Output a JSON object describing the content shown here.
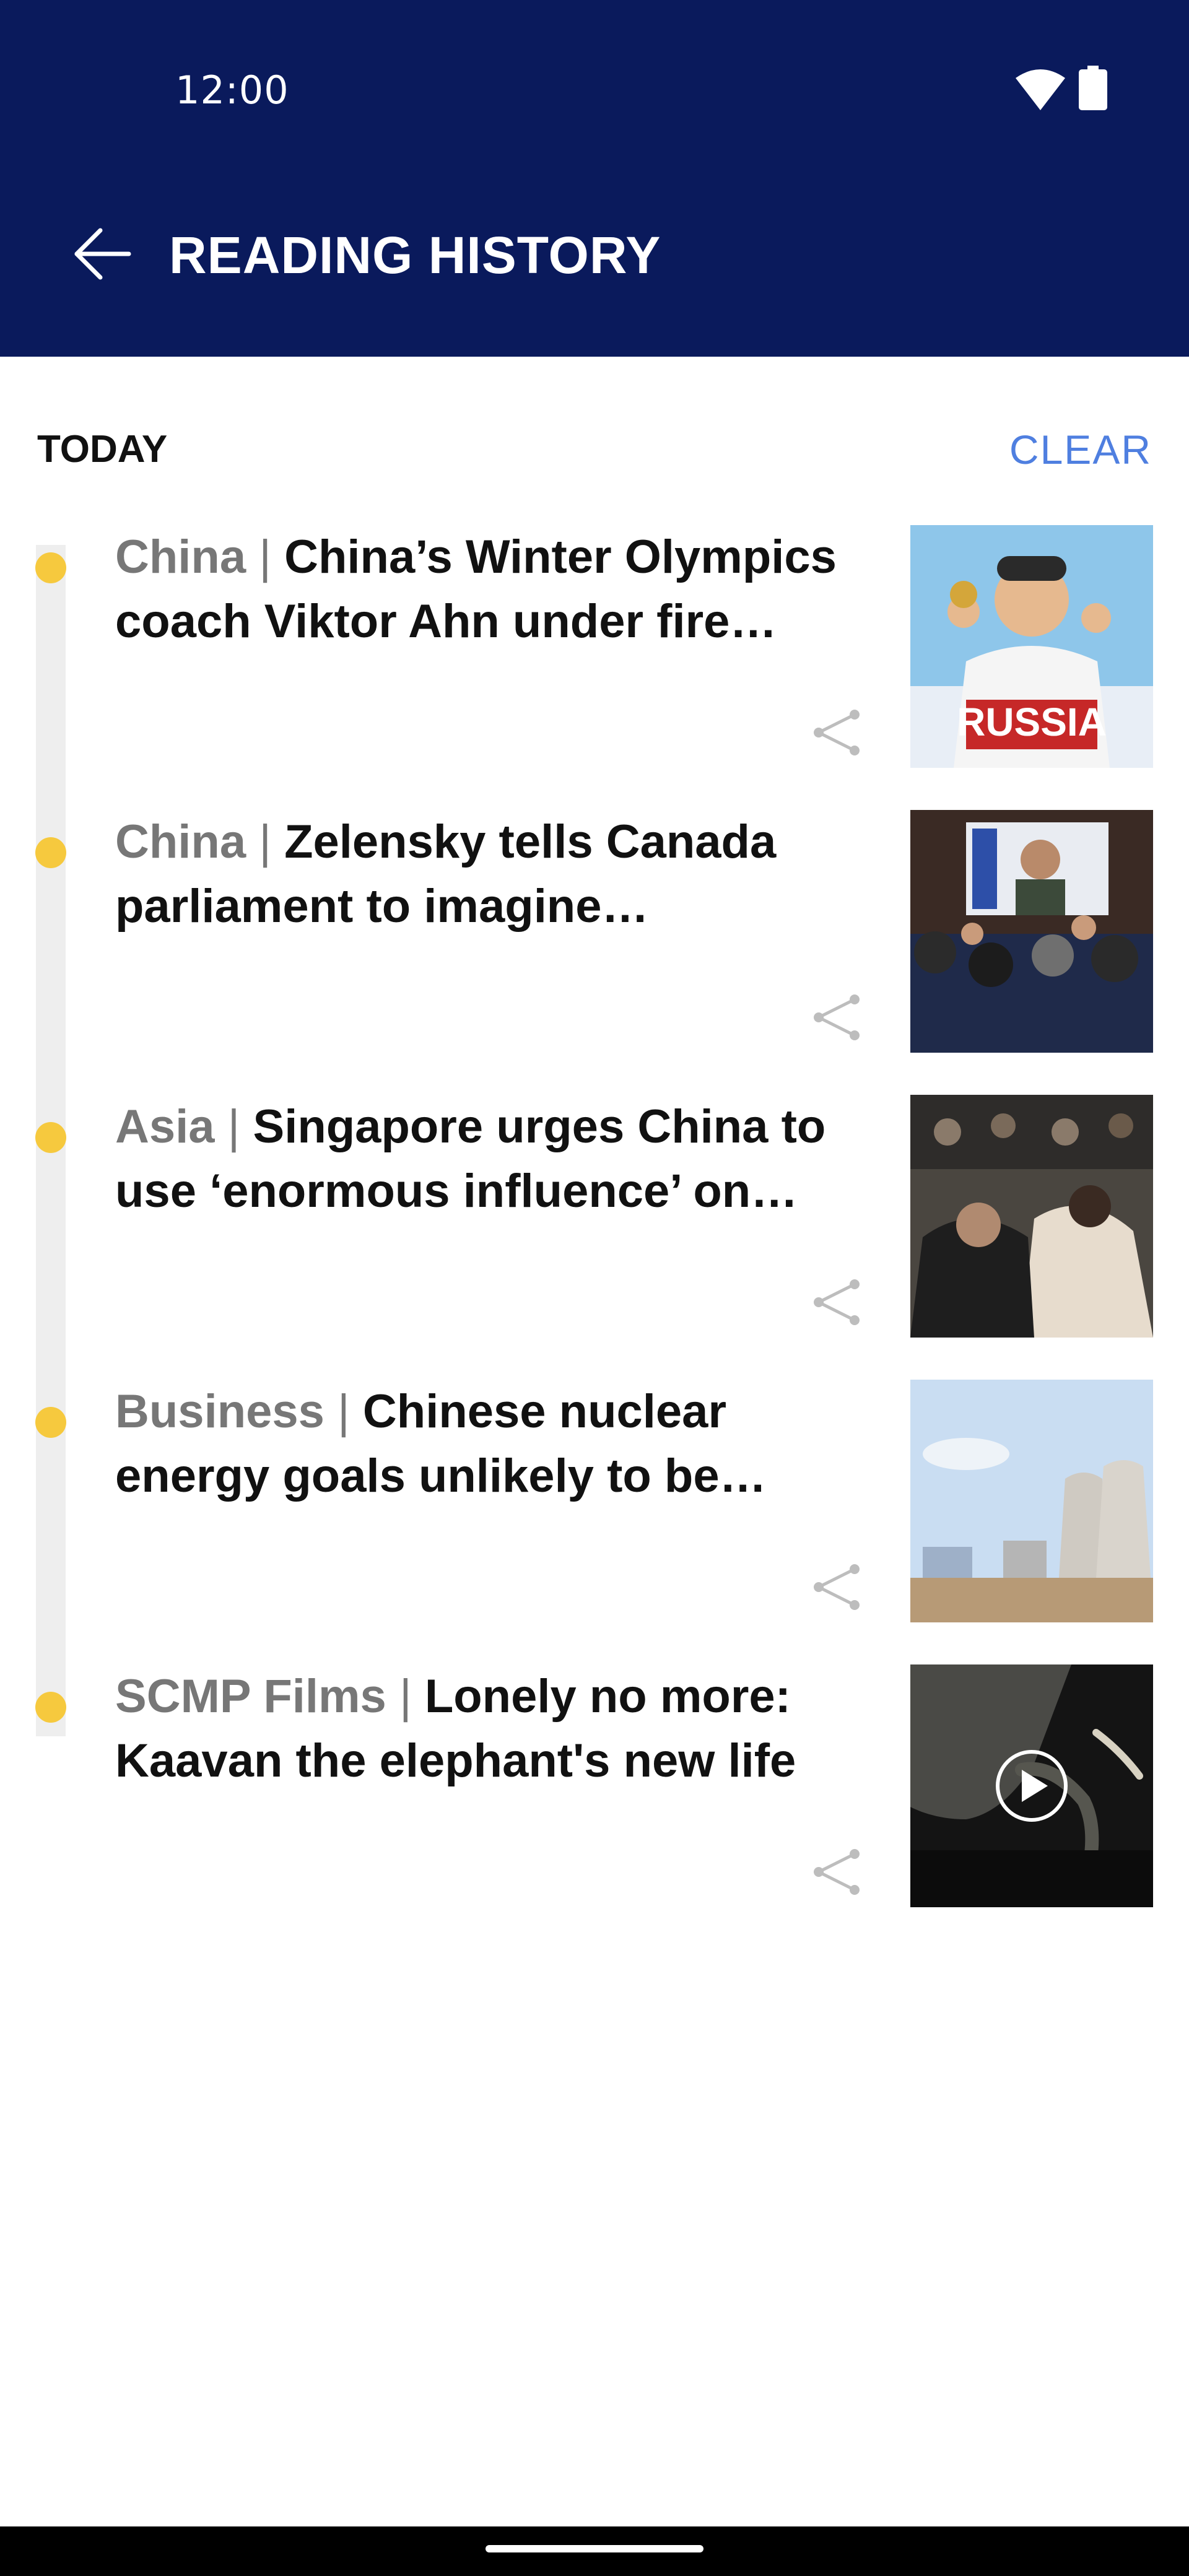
{
  "status_bar": {
    "time": "12:00",
    "icons": [
      "wifi-icon",
      "battery-icon"
    ]
  },
  "app_bar": {
    "back_icon": "arrow-left-icon",
    "title": "READING HISTORY"
  },
  "section": {
    "label": "TODAY",
    "clear_label": "CLEAR"
  },
  "colors": {
    "header_bg": "#0a1a5c",
    "accent_link": "#4f7fe0",
    "timeline_dot": "#f6c93e",
    "category_text": "#777777"
  },
  "articles": [
    {
      "category": "China",
      "separator": " | ",
      "headline": "China’s Winter Olympics coach Viktor Ahn under fire afte…",
      "thumbnail": "skater-medal-photo",
      "thumb_text": "RUSSIA",
      "share_icon": "share-icon"
    },
    {
      "category": "China",
      "separator": " | ",
      "headline": "Zelensky tells Canada parliament to imagine Vancouve…",
      "thumbnail": "parliament-applause-photo",
      "share_icon": "share-icon"
    },
    {
      "category": "Asia",
      "separator": " | ",
      "headline": "Singapore urges China to use ‘enormous influence’ on Ru…",
      "thumbnail": "crowd-embrace-photo",
      "share_icon": "share-icon"
    },
    {
      "category": "Business",
      "separator": " | ",
      "headline": "Chinese nuclear energy goals unlikely to be upen…",
      "thumbnail": "nuclear-plant-photo",
      "share_icon": "share-icon"
    },
    {
      "category": "SCMP Films",
      "separator": " | ",
      "headline": "Lonely no more: Kaavan the elephant's new life",
      "thumbnail": "elephant-video-thumbnail",
      "play_icon": "play-icon",
      "share_icon": "share-icon"
    }
  ],
  "nav_bar": {
    "handle": "gesture-handle"
  }
}
